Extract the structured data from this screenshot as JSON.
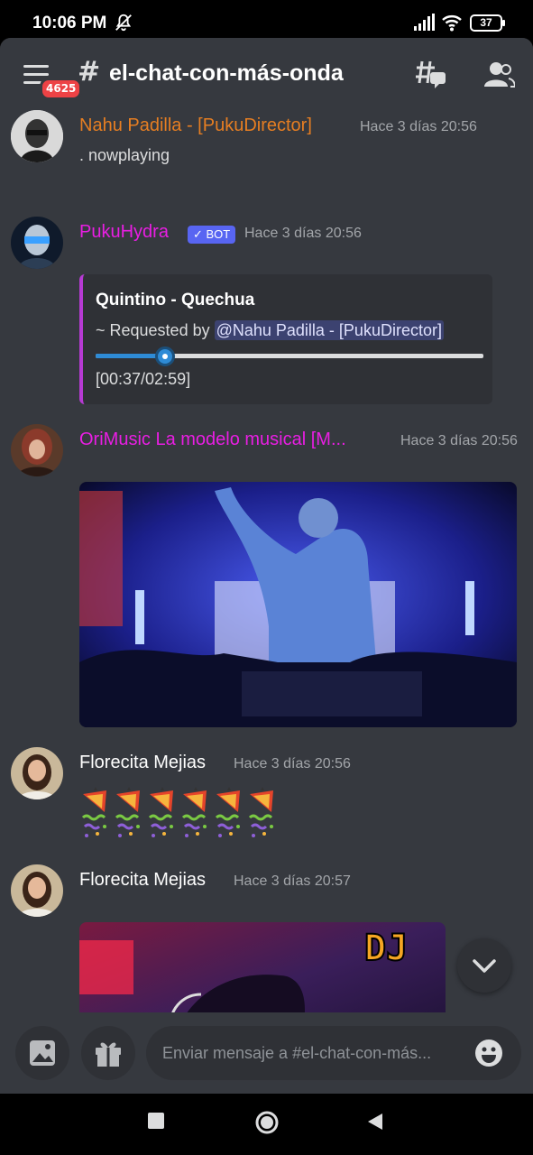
{
  "status_bar": {
    "time": "10:06 PM",
    "battery": "37"
  },
  "header": {
    "badge_count": "4625",
    "channel_hash": "#",
    "channel_name": "el-chat-con-más-onda"
  },
  "messages": [
    {
      "author": "Nahu Padilla - [PukuDirector]",
      "author_color": "#e67e22",
      "timestamp": "Hace 3 días 20:56",
      "text": ". nowplaying"
    },
    {
      "author": "PukuHydra",
      "author_color": "#e91ee3",
      "bot_tag": "✓ BOT",
      "timestamp": "Hace 3 días 20:56",
      "embed": {
        "title": "Quintino - Quechua",
        "requested_prefix": "~ Requested by ",
        "mention": "@Nahu Padilla - [PukuDirector]",
        "progress_fraction": 0.18,
        "time": "[00:37/02:59]"
      }
    },
    {
      "author": "OriMusic La modelo musical [M...",
      "author_color": "#e91ee3",
      "timestamp": "Hace 3 días 20:56"
    },
    {
      "author": "Florecita Mejias",
      "author_color": "#ffffff",
      "timestamp": "Hace 3 días 20:56",
      "emoji_count": 6
    },
    {
      "author": "Florecita Mejias",
      "author_color": "#ffffff",
      "timestamp": "Hace 3 días 20:57",
      "media_text": "DJ"
    }
  ],
  "composer": {
    "placeholder": "Enviar mensaje a #el-chat-con-más..."
  },
  "icons": {
    "menu": "hamburger-icon",
    "threads": "threads-icon",
    "members": "members-icon",
    "image": "image-icon",
    "gift": "gift-icon",
    "emoji": "emoji-icon"
  }
}
